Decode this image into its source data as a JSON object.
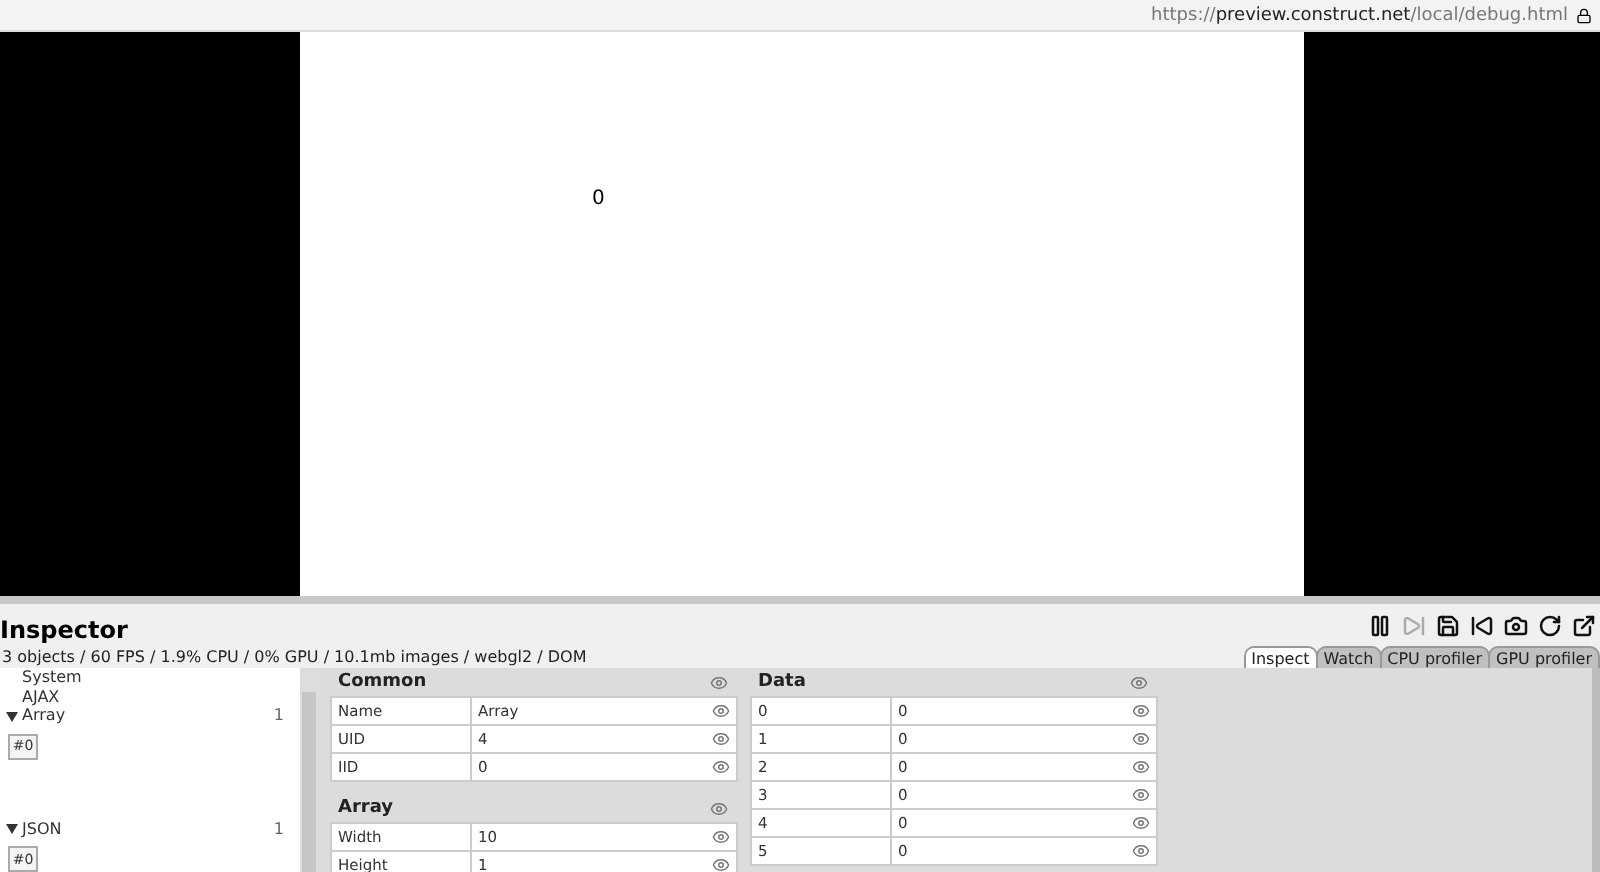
{
  "browser": {
    "url_scheme": "https://",
    "url_host": "preview.construct.net",
    "url_path": "/local/debug.html"
  },
  "game": {
    "text": "0"
  },
  "inspector": {
    "title": "Inspector",
    "stats": "3 objects / 60 FPS / 1.9% CPU / 0% GPU / 10.1mb images / webgl2 / DOM",
    "toolbar": [
      {
        "kind": "pause",
        "disabled": false
      },
      {
        "kind": "step",
        "disabled": true
      },
      {
        "kind": "save",
        "disabled": false
      },
      {
        "kind": "restart",
        "disabled": false
      },
      {
        "kind": "screenshot",
        "disabled": false
      },
      {
        "kind": "reload",
        "disabled": false
      },
      {
        "kind": "popout",
        "disabled": false
      }
    ],
    "tabs": [
      {
        "label": "Inspect",
        "selected": true
      },
      {
        "label": "Watch",
        "selected": false
      },
      {
        "label": "CPU profiler",
        "selected": false
      },
      {
        "label": "GPU profiler",
        "selected": false
      }
    ],
    "tree": [
      {
        "label": "System"
      },
      {
        "label": "AJAX"
      },
      {
        "label": "Array",
        "expanded": true,
        "count": "1",
        "instances": [
          "#0"
        ]
      },
      {
        "label": "JSON",
        "expanded": true,
        "count": "1",
        "instances": [
          "#0"
        ]
      }
    ],
    "sections": [
      {
        "title": "Common",
        "rows": [
          {
            "key": "Name",
            "value": "Array"
          },
          {
            "key": "UID",
            "value": "4"
          },
          {
            "key": "IID",
            "value": "0"
          }
        ]
      },
      {
        "title": "Array",
        "rows": [
          {
            "key": "Width",
            "value": "10"
          },
          {
            "key": "Height",
            "value": "1"
          }
        ]
      }
    ],
    "data": {
      "title": "Data",
      "rows": [
        {
          "key": "0",
          "value": "0"
        },
        {
          "key": "1",
          "value": "0"
        },
        {
          "key": "2",
          "value": "0"
        },
        {
          "key": "3",
          "value": "0"
        },
        {
          "key": "4",
          "value": "0"
        },
        {
          "key": "5",
          "value": "0"
        }
      ]
    }
  }
}
